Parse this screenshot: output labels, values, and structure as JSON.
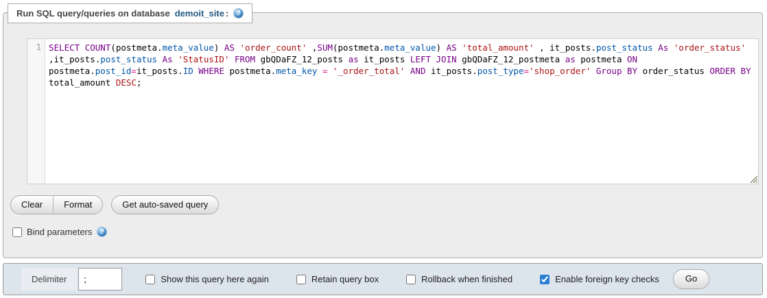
{
  "colors": {
    "link": "#235a81",
    "keyword": "#770088",
    "string": "#aa1111",
    "column": "#0055aa",
    "operator": "#e0218a",
    "accent": "#2a7ed3"
  },
  "icons": {
    "help": "?"
  },
  "legend": {
    "prefix": "Run SQL query/queries on database",
    "database": "demoit_site",
    "suffix": ":"
  },
  "editor": {
    "line_number": "1",
    "sql_full": "SELECT COUNT(postmeta.meta_value) AS 'order_count' ,SUM(postmeta.meta_value) AS 'total_amount' , it_posts.post_status As 'order_status' ,it_posts.post_status As 'StatusID' FROM gbQDaFZ_12_posts as it_posts LEFT JOIN gbQDaFZ_12_postmeta as postmeta ON postmeta.post_id=it_posts.ID WHERE postmeta.meta_key = '_order_total' AND it_posts.post_type='shop_order' Group BY order_status ORDER BY total_amount DESC;",
    "lines": [
      [
        [
          "k",
          "SELECT"
        ],
        [
          "p",
          " "
        ],
        [
          "k",
          "COUNT"
        ],
        [
          "p",
          "(postmeta."
        ],
        [
          "c",
          "meta_value"
        ],
        [
          "p",
          ") "
        ],
        [
          "k",
          "AS"
        ],
        [
          "p",
          " "
        ],
        [
          "s",
          "'order_count'"
        ],
        [
          "p",
          " ,"
        ],
        [
          "k",
          "SUM"
        ],
        [
          "p",
          "(postmeta."
        ],
        [
          "c",
          "meta_value"
        ],
        [
          "p",
          ") "
        ],
        [
          "k",
          "AS"
        ],
        [
          "p",
          " "
        ],
        [
          "s",
          "'total_amount'"
        ],
        [
          "p",
          " , it_posts."
        ],
        [
          "c",
          "post_status"
        ],
        [
          "p",
          " "
        ],
        [
          "k",
          "As"
        ],
        [
          "p",
          " "
        ],
        [
          "s",
          "'order_status'"
        ]
      ],
      [
        [
          "p",
          ",it_posts."
        ],
        [
          "c",
          "post_status"
        ],
        [
          "p",
          " "
        ],
        [
          "k",
          "As"
        ],
        [
          "p",
          " "
        ],
        [
          "s",
          "'StatusID'"
        ],
        [
          "p",
          " "
        ],
        [
          "k",
          "FROM"
        ],
        [
          "p",
          " gbQDaFZ_12_posts "
        ],
        [
          "k",
          "as"
        ],
        [
          "p",
          " it_posts "
        ],
        [
          "k",
          "LEFT JOIN"
        ],
        [
          "p",
          " gbQDaFZ_12_postmeta "
        ],
        [
          "k",
          "as"
        ],
        [
          "p",
          " postmeta "
        ],
        [
          "k",
          "ON"
        ]
      ],
      [
        [
          "p",
          "postmeta."
        ],
        [
          "c",
          "post_id"
        ],
        [
          "o",
          "="
        ],
        [
          "p",
          "it_posts."
        ],
        [
          "c",
          "ID"
        ],
        [
          "p",
          " "
        ],
        [
          "k",
          "WHERE"
        ],
        [
          "p",
          " postmeta."
        ],
        [
          "c",
          "meta_key"
        ],
        [
          "p",
          " "
        ],
        [
          "o",
          "="
        ],
        [
          "p",
          " "
        ],
        [
          "s",
          "'_order_total'"
        ],
        [
          "p",
          " "
        ],
        [
          "k",
          "AND"
        ],
        [
          "p",
          " it_posts."
        ],
        [
          "c",
          "post_type"
        ],
        [
          "o",
          "="
        ],
        [
          "s",
          "'shop_order'"
        ],
        [
          "p",
          " "
        ],
        [
          "k",
          "Group BY"
        ],
        [
          "p",
          " order_status "
        ],
        [
          "k",
          "ORDER BY"
        ]
      ],
      [
        [
          "p",
          "total_amount "
        ],
        [
          "s",
          "DESC"
        ],
        [
          "p",
          ";"
        ]
      ]
    ]
  },
  "actions": {
    "clear": "Clear",
    "format": "Format",
    "get_autosaved": "Get auto-saved query"
  },
  "bind_params": {
    "label": "Bind parameters",
    "checked": false
  },
  "footer": {
    "delimiter_label": "Delimiter",
    "delimiter_value": ";",
    "options": [
      {
        "label": "Show this query here again",
        "checked": false
      },
      {
        "label": "Retain query box",
        "checked": false
      },
      {
        "label": "Rollback when finished",
        "checked": false
      },
      {
        "label": "Enable foreign key checks",
        "checked": true
      }
    ],
    "go": "Go"
  }
}
